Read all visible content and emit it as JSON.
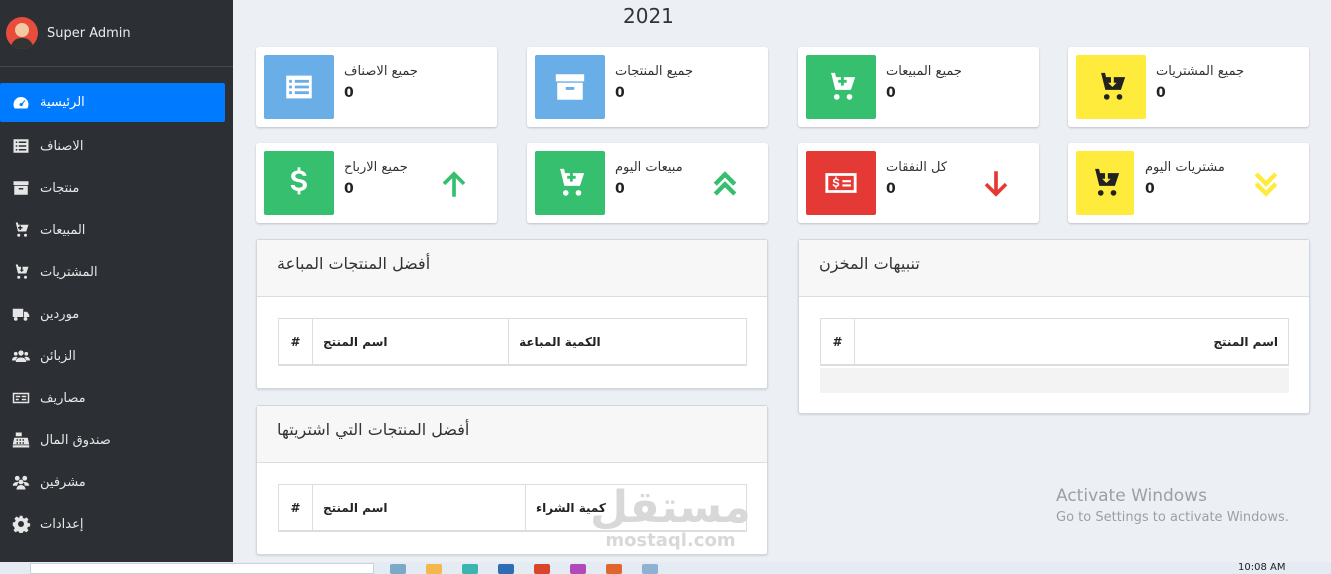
{
  "sidebar": {
    "user_name": "Super Admin",
    "items": [
      {
        "label": "الرئيسية",
        "icon": "dashboard-icon",
        "active": true
      },
      {
        "label": "الاصناف",
        "icon": "list-icon"
      },
      {
        "label": "منتجات",
        "icon": "archive-icon"
      },
      {
        "label": "المبيعات",
        "icon": "cart-plus-icon"
      },
      {
        "label": "المشتريات",
        "icon": "cart-download-icon"
      },
      {
        "label": "موردين",
        "icon": "truck-icon"
      },
      {
        "label": "الزبائن",
        "icon": "users-icon"
      },
      {
        "label": "مصاريف",
        "icon": "money-icon"
      },
      {
        "label": "صندوق المال",
        "icon": "cash-register-icon"
      },
      {
        "label": "مشرفين",
        "icon": "user-group-icon"
      },
      {
        "label": "إعدادات",
        "icon": "gear-icon"
      }
    ]
  },
  "header": {
    "year": "2021"
  },
  "stats": [
    {
      "label": "جميع الاصناف",
      "value": "0",
      "icon": "list-icon",
      "color": "#6aaee8"
    },
    {
      "label": "جميع المنتجات",
      "value": "0",
      "icon": "archive-icon",
      "color": "#6aaee8"
    },
    {
      "label": "جميع المبيعات",
      "value": "0",
      "icon": "cart-plus-icon",
      "color": "#35bf6e"
    },
    {
      "label": "جميع المشتريات",
      "value": "0",
      "icon": "cart-download-icon",
      "color": "#ffeb3b"
    },
    {
      "label": "جميع الارباح",
      "value": "0",
      "icon": "dollar-icon",
      "color": "#35bf6e",
      "trend": "arrow-up-icon"
    },
    {
      "label": "مبيعات اليوم",
      "value": "0",
      "icon": "cart-plus-icon",
      "color": "#35bf6e",
      "trend": "double-chevron-up-icon"
    },
    {
      "label": "كل النفقات",
      "value": "0",
      "icon": "money-bill-icon",
      "color": "#e53935",
      "trend": "arrow-down-icon"
    },
    {
      "label": "مشتريات اليوم",
      "value": "0",
      "icon": "cart-download-icon",
      "color": "#ffeb3b",
      "trend": "double-chevron-down-icon"
    }
  ],
  "panels": {
    "top_sold": {
      "title": "أفضل المنتجات المباعة",
      "columns": [
        "#",
        "اسم المنتج",
        "الكمية المباعة"
      ]
    },
    "top_purchased": {
      "title": "أفضل المنتجات التي اشتريتها",
      "columns": [
        "#",
        "اسم المنتج",
        "كمية الشراء"
      ]
    },
    "stock_alerts": {
      "title": "تنبيهات المخزن",
      "columns": [
        "#",
        "اسم المنتج"
      ]
    }
  },
  "watermark": {
    "arabic": "مستقل",
    "latin": "mostaql.com"
  },
  "windows": {
    "activate_title": "Activate Windows",
    "activate_sub": "Go to Settings to activate Windows."
  },
  "taskbar": {
    "time": "10:08 AM"
  },
  "colors": {
    "sidebar_bg": "#2c2f33",
    "active": "#007bff",
    "green": "#35bf6e",
    "blue": "#6aaee8",
    "yellow": "#ffeb3b",
    "red": "#e53935"
  }
}
